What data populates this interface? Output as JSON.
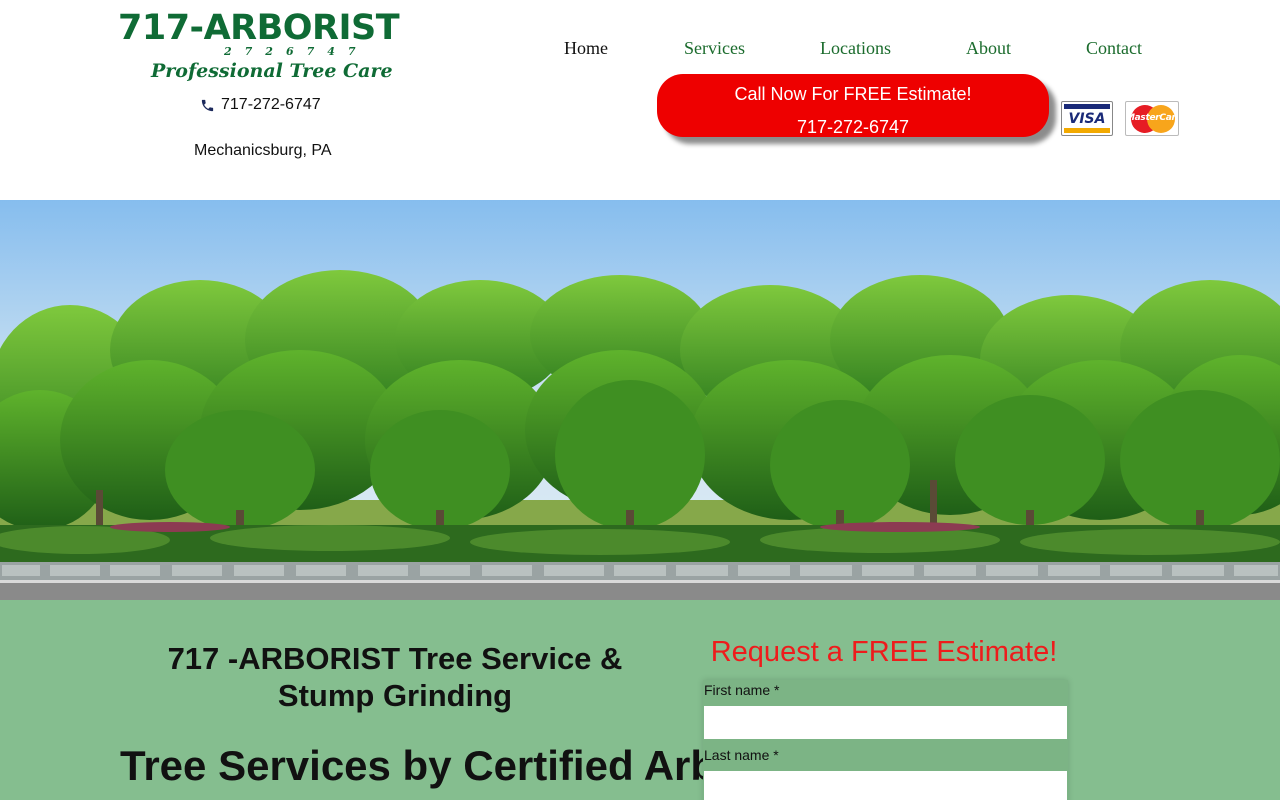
{
  "brand": {
    "name": "717-ARBORIST",
    "digits": "2726747",
    "tagline": "Professional Tree Care"
  },
  "contact": {
    "phone": "717-272-6747",
    "location": "Mechanicsburg, PA"
  },
  "nav": {
    "items": [
      {
        "label": "Home",
        "active": true
      },
      {
        "label": "Services",
        "active": false
      },
      {
        "label": "Locations",
        "active": false
      },
      {
        "label": "About",
        "active": false
      },
      {
        "label": "Contact",
        "active": false
      }
    ]
  },
  "cta": {
    "line1": "Call Now For FREE Estimate!",
    "line2": "717-272-6747"
  },
  "payment": {
    "visa": "VISA",
    "mastercard": "MasterCard"
  },
  "hero": {
    "image": "row-of-trees-photo"
  },
  "main": {
    "heading": "717 -ARBORIST Tree Service & Stump Grinding",
    "subheading": "Tree Services by Certified Arborists"
  },
  "form": {
    "title": "Request a FREE Estimate!",
    "first_name_label": "First name *",
    "first_name_value": "",
    "last_name_label": "Last name *",
    "last_name_value": ""
  },
  "colors": {
    "brand_green": "#0f6b35",
    "nav_green": "#1a6b2c",
    "cta_red": "#ee0000",
    "section_green": "#85be8f",
    "form_title_red": "#ee1c1c"
  }
}
